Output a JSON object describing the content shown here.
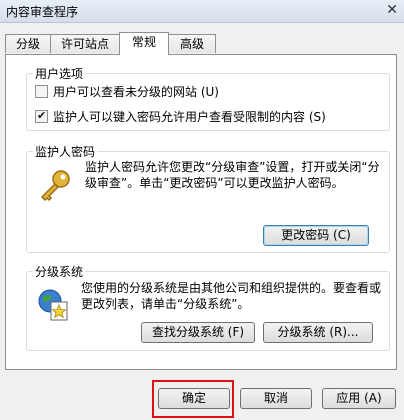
{
  "window": {
    "title": "内容审查程序",
    "close_glyph": "✕"
  },
  "tabs": [
    {
      "label": "分级"
    },
    {
      "label": "许可站点"
    },
    {
      "label": "常规"
    },
    {
      "label": "高级"
    }
  ],
  "user_options": {
    "label": "用户选项",
    "options": [
      {
        "label": "用户可以查看未分级的网站 (U)",
        "checked": false
      },
      {
        "label": "监护人可以键入密码允许用户查看受限制的内容 (S)",
        "checked": true
      }
    ]
  },
  "supervisor": {
    "label": "监护人密码",
    "description": "监护人密码允许您更改“分级审查”设置，打开或关闭“分级审查”。单击“更改密码”可以更改监护人密码。",
    "icon": "key-icon",
    "change_password_label": "更改密码 (C)"
  },
  "rating_systems": {
    "label": "分级系统",
    "description": "您使用的分级系统是由其他公司和组织提供的。要查看或更改列表，请单击“分级系统”。",
    "icon": "rating-document-icon",
    "find_label": "查找分级系统 (F)",
    "systems_label": "分级系统 (R)..."
  },
  "footer": {
    "ok_label": "确定",
    "cancel_label": "取消",
    "apply_label": "应用 (A)"
  }
}
